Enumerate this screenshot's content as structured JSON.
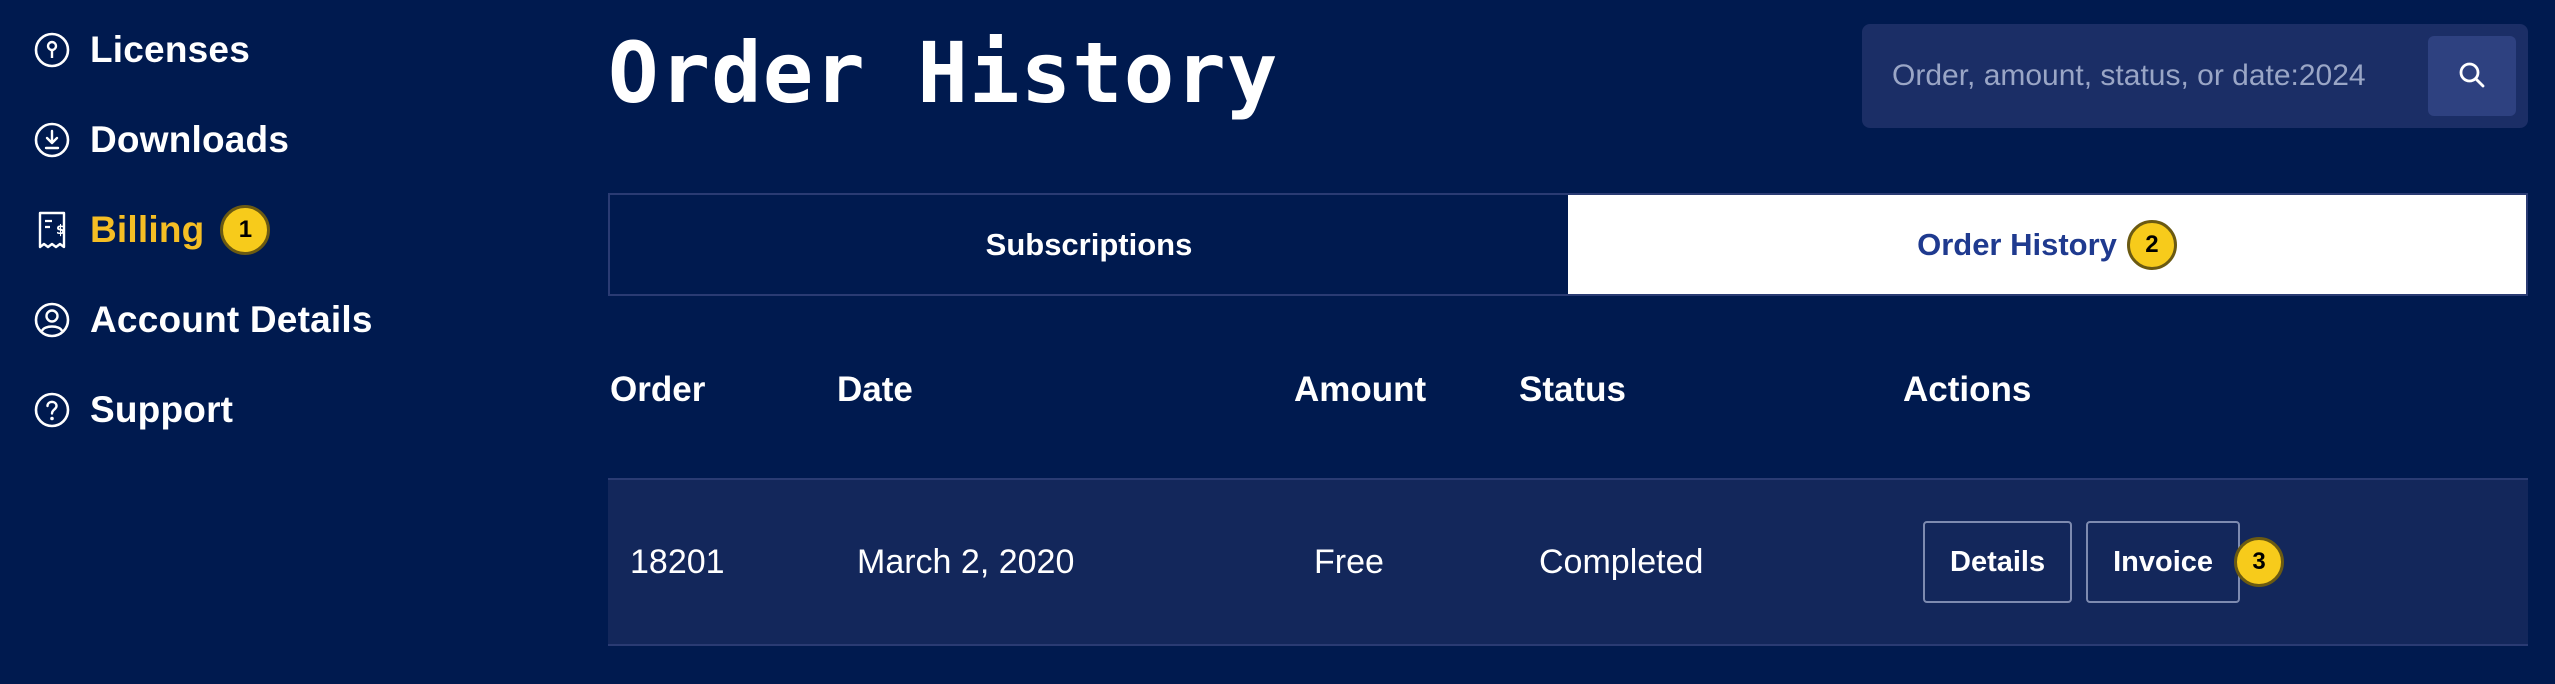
{
  "sidebar": {
    "items": [
      {
        "label": "Licenses",
        "icon": "license-key-icon",
        "active": false
      },
      {
        "label": "Downloads",
        "icon": "download-icon",
        "active": false
      },
      {
        "label": "Billing",
        "icon": "receipt-icon",
        "active": true,
        "badge": "1"
      },
      {
        "label": "Account Details",
        "icon": "user-circle-icon",
        "active": false
      },
      {
        "label": "Support",
        "icon": "help-circle-icon",
        "active": false
      }
    ]
  },
  "header": {
    "title": "Order History",
    "search": {
      "placeholder": "Order, amount, status, or date:2024",
      "value": "",
      "button_icon": "search-icon"
    }
  },
  "tabs": [
    {
      "label": "Subscriptions",
      "active": false
    },
    {
      "label": "Order History",
      "active": true,
      "badge": "2"
    }
  ],
  "table": {
    "columns": [
      "Order",
      "Date",
      "Amount",
      "Status",
      "Actions"
    ],
    "rows": [
      {
        "order": "18201",
        "date": "March 2, 2020",
        "amount": "Free",
        "status": "Completed",
        "actions": [
          "Details",
          "Invoice"
        ],
        "badge": "3"
      }
    ]
  },
  "colors": {
    "background": "#001a4f",
    "active_accent": "#f5be24",
    "badge": "#f7cb1b",
    "active_tab_text": "#1f3a8f",
    "row_background": "#13275b"
  }
}
